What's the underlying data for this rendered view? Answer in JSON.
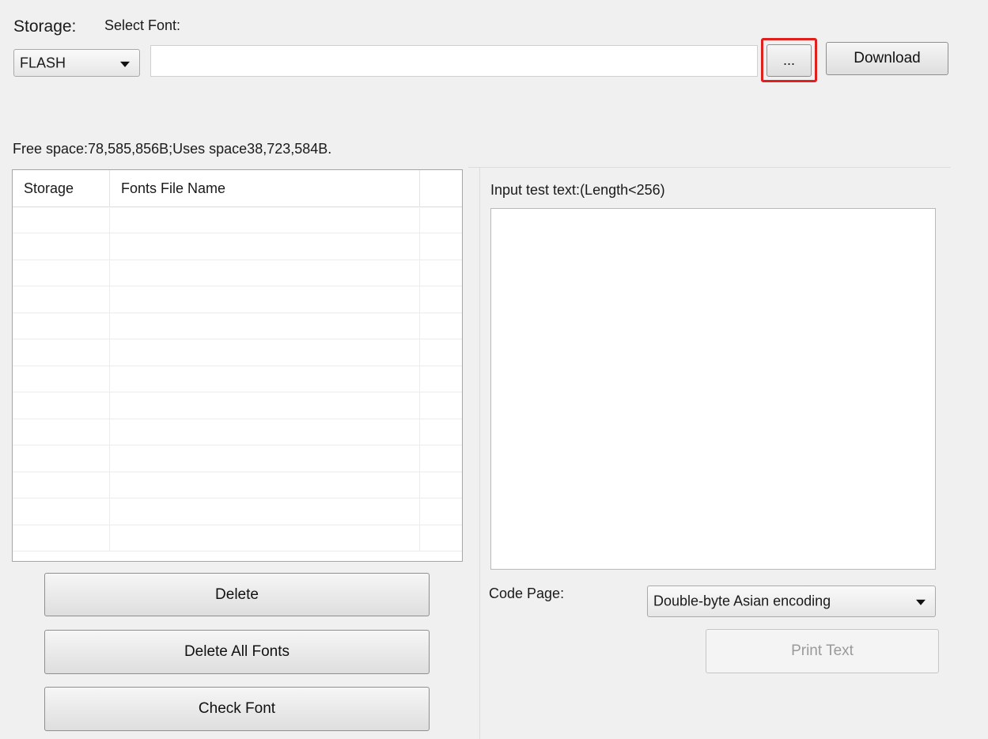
{
  "top": {
    "storage_label": "Storage:",
    "select_font_label": "Select Font:",
    "storage_value": "FLASH",
    "font_path_value": "",
    "browse_label": "...",
    "download_label": "Download"
  },
  "space_info": "Free space:78,585,856B;Uses space38,723,584B.",
  "fonts_table": {
    "columns": [
      "Storage",
      "Fonts File Name",
      ""
    ],
    "rows": []
  },
  "left_buttons": {
    "delete": "Delete",
    "delete_all": "Delete All Fonts",
    "check": "Check Font"
  },
  "right": {
    "input_label": "Input test text:(Length<256)",
    "test_text": "",
    "code_page_label": "Code Page:",
    "code_page_value": "Double-byte Asian encoding",
    "print_label": "Print Text"
  },
  "colors": {
    "highlight": "#e0201c",
    "background": "#f0f0f0"
  }
}
